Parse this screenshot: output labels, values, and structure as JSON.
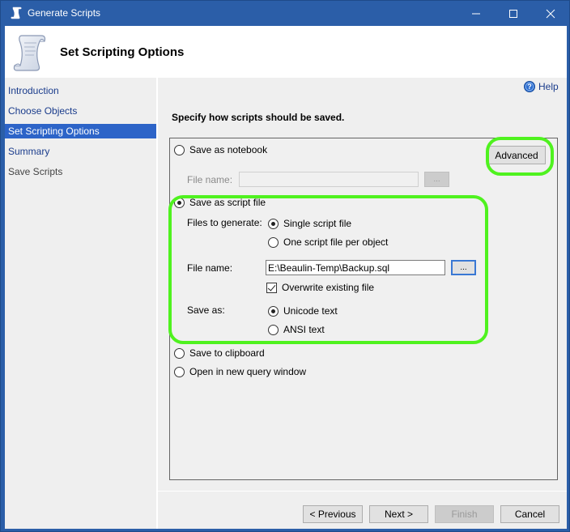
{
  "window": {
    "title": "Generate Scripts",
    "controls": {
      "minimize": "minimize",
      "maximize": "maximize",
      "close": "close"
    }
  },
  "header": {
    "page_title": "Set Scripting Options",
    "icon": "scroll-icon"
  },
  "sidebar": {
    "items": [
      {
        "label": "Introduction",
        "state": "link"
      },
      {
        "label": "Choose Objects",
        "state": "link"
      },
      {
        "label": "Set Scripting Options",
        "state": "active"
      },
      {
        "label": "Summary",
        "state": "link"
      },
      {
        "label": "Save Scripts",
        "state": "disabled"
      }
    ]
  },
  "content": {
    "help_label": "Help",
    "instruction": "Specify how scripts should be saved.",
    "advanced_label": "Advanced",
    "notebook": {
      "label": "Save as notebook",
      "selected": false,
      "file_name_label": "File name:",
      "file_name_value": "",
      "browse_label": "..."
    },
    "script_file": {
      "label": "Save as script file",
      "selected": true,
      "files_to_generate_label": "Files to generate:",
      "files_options": [
        {
          "label": "Single script file",
          "selected": true
        },
        {
          "label": "One script file per object",
          "selected": false
        }
      ],
      "file_name_label": "File name:",
      "file_name_value": "E:\\Beaulin-Temp\\Backup.sql",
      "browse_label": "...",
      "overwrite_label": "Overwrite existing file",
      "overwrite_checked": true,
      "save_as_label": "Save as:",
      "save_as_options": [
        {
          "label": "Unicode text",
          "selected": true
        },
        {
          "label": "ANSI text",
          "selected": false
        }
      ]
    },
    "clipboard": {
      "label": "Save to clipboard",
      "selected": false
    },
    "query_window": {
      "label": "Open in new query window",
      "selected": false
    }
  },
  "footer": {
    "previous_label": "< Previous",
    "next_label": "Next >",
    "finish_label": "Finish",
    "cancel_label": "Cancel"
  },
  "colors": {
    "titlebar": "#2b5ea8",
    "sidebar_active": "#2d64c8",
    "link": "#1a3c8c",
    "highlight": "#4ff21f"
  }
}
